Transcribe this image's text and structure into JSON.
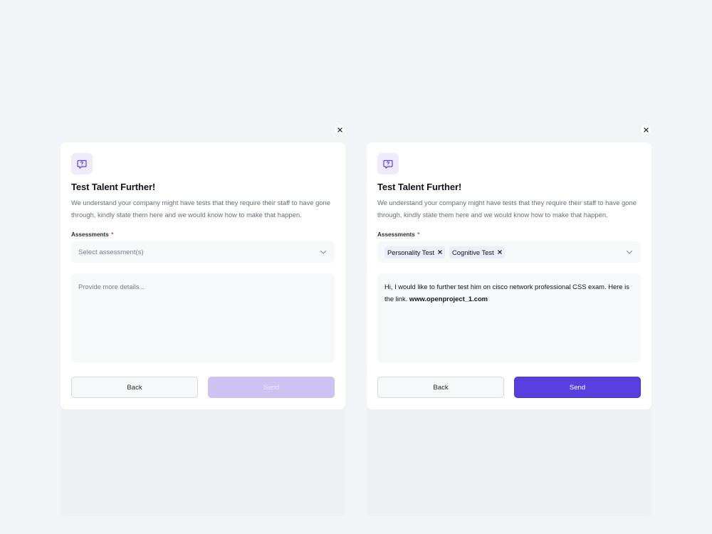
{
  "colors": {
    "background": "#f3f4f7",
    "accent": "#5a3fe0",
    "accent_disabled": "#cdc3f3",
    "icon_bg": "#efebfb",
    "required": "#e5484d"
  },
  "modals": [
    {
      "state": "empty",
      "icon": "question-chat-icon",
      "title": "Test Talent Further!",
      "description": "We understand your company might have tests that they require their staff to have gone through, kindly state them here and we would know how to make that happen.",
      "assessments_label": "Assessments",
      "required_mark": "*",
      "select_placeholder": "Select assessment(s)",
      "details_placeholder": "Provide more details...",
      "back_label": "Back",
      "send_label": "Send"
    },
    {
      "state": "filled",
      "icon": "question-chat-icon",
      "title": "Test Talent Further!",
      "description": "We understand your company might have tests that they require their staff to have gone through, kindly state them here and we would know how to make that happen.",
      "assessments_label": "Assessments",
      "required_mark": "*",
      "selected_tags": [
        "Personality Test",
        "Cognitive Test"
      ],
      "details_text": "Hi, I would like to further test him on cisco network professional CSS exam. Here is the link. ",
      "details_link": "www.openproject_1.com",
      "back_label": "Back",
      "send_label": "Send"
    }
  ]
}
